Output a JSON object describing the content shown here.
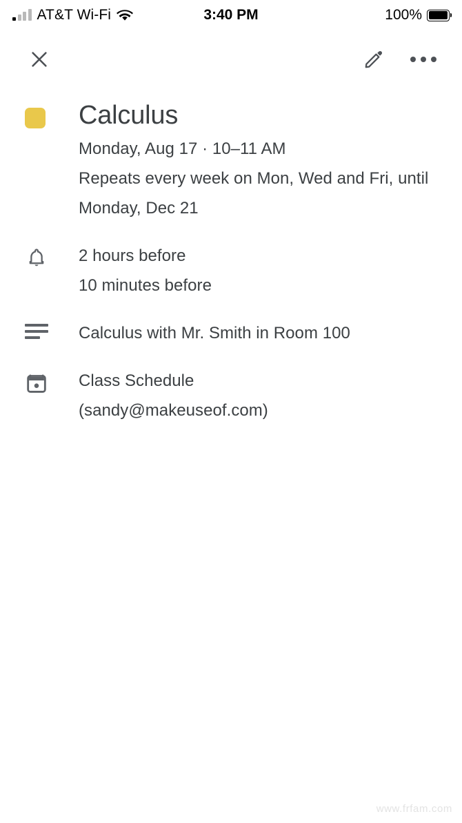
{
  "status_bar": {
    "carrier": "AT&T Wi-Fi",
    "wifi_icon": "wifi-icon",
    "signal_icon": "cellular-signal-icon",
    "time": "3:40 PM",
    "battery_percent": "100%",
    "battery_icon": "battery-full-icon"
  },
  "toolbar": {
    "close_icon": "close-icon",
    "edit_icon": "pencil-icon",
    "more_icon": "more-options-icon"
  },
  "event": {
    "color_swatch": "#e9c84b",
    "title": "Calculus",
    "when": "Monday, Aug 17 · 10–11 AM",
    "recurrence": "Repeats every week on Mon, Wed and Fri, until Monday, Dec 21",
    "notifications": {
      "icon": "bell-icon",
      "items": [
        "2 hours before",
        "10 minutes before"
      ]
    },
    "description": {
      "icon": "description-icon",
      "text": "Calculus with Mr. Smith in Room 100"
    },
    "calendar": {
      "icon": "calendar-icon",
      "name": "Class Schedule",
      "account": "(sandy@makeuseof.com)"
    }
  },
  "watermark": "www.frfam.com"
}
